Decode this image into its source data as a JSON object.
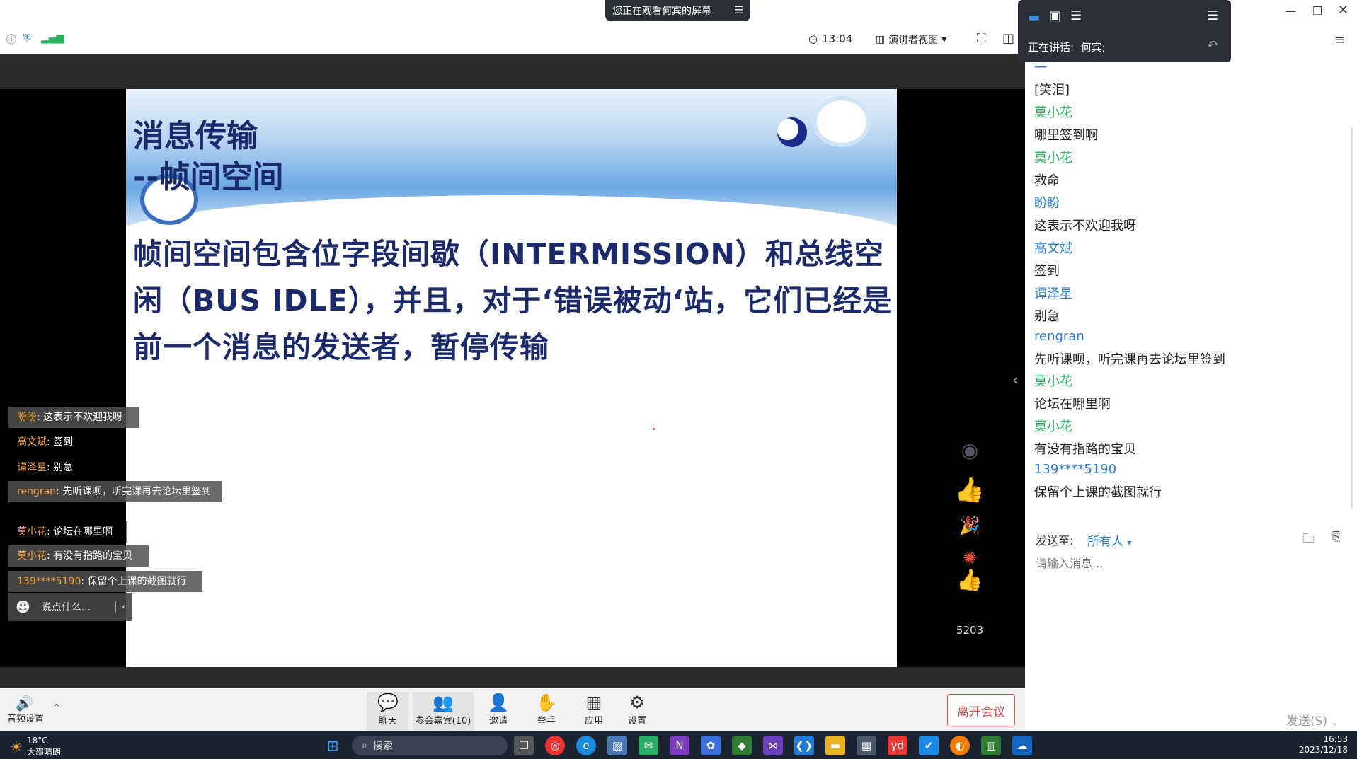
{
  "top_bar": {
    "share_banner": "您正在观看何宾的屏幕",
    "time": "13:04",
    "view_mode": "演讲者视图"
  },
  "slide": {
    "title_line1": "消息传输",
    "title_line2": "--帧间空间",
    "body": "帧间空间包含位字段间歇（INTERMISSION）和总线空闲（BUS IDLE），并且，对于‘错误被动‘站，它们已经是前一个消息的发送者，暂停传输"
  },
  "overlay_chat": [
    {
      "name": "盼盼",
      "text": "这表示不欢迎我呀"
    },
    {
      "name": "高文斌",
      "text": "签到"
    },
    {
      "name": "谭泽星",
      "text": "别急"
    },
    {
      "name": "rengran",
      "text": "先听课呗，听完课再去论坛里签到"
    },
    {
      "name": "莫小花",
      "text": "论坛在哪里啊"
    },
    {
      "name": "莫小花",
      "text": "有没有指路的宝贝"
    },
    {
      "name": "139****5190",
      "text": "保留个上课的截图就行"
    }
  ],
  "overlay_input_placeholder": "说点什么...",
  "likes": "5203",
  "speaking": {
    "label": "正在讲话:",
    "name": "何宾;"
  },
  "chat_panel": {
    "messages": [
      {
        "name": "",
        "text": "[笑泪]"
      },
      {
        "name": "莫小花",
        "text": "哪里签到啊"
      },
      {
        "name": "莫小花",
        "text": "救命"
      },
      {
        "name": "盼盼",
        "text": "这表示不欢迎我呀"
      },
      {
        "name": "高文斌",
        "text": "签到"
      },
      {
        "name": "谭泽星",
        "text": "别急"
      },
      {
        "name": "rengran",
        "text": "先听课呗，听完课再去论坛里签到"
      },
      {
        "name": "莫小花",
        "text": "论坛在哪里啊"
      },
      {
        "name": "莫小花",
        "text": "有没有指路的宝贝"
      },
      {
        "name": "139****5190",
        "text": "保留个上课的截图就行"
      }
    ],
    "send_to_label": "发送至:",
    "send_to_value": "所有人",
    "input_placeholder": "请输入消息...",
    "send_button": "发送(S)"
  },
  "toolbar": {
    "audio": "音频设置",
    "chat": "聊天",
    "participants": "参会嘉宾(10)",
    "invite": "邀请",
    "raise_hand": "举手",
    "apps": "应用",
    "settings": "设置",
    "leave": "离开会议"
  },
  "taskbar": {
    "temp": "18°C",
    "weather": "大部晴朗",
    "search": "搜索",
    "time": "16:53",
    "date": "2023/12/18"
  }
}
